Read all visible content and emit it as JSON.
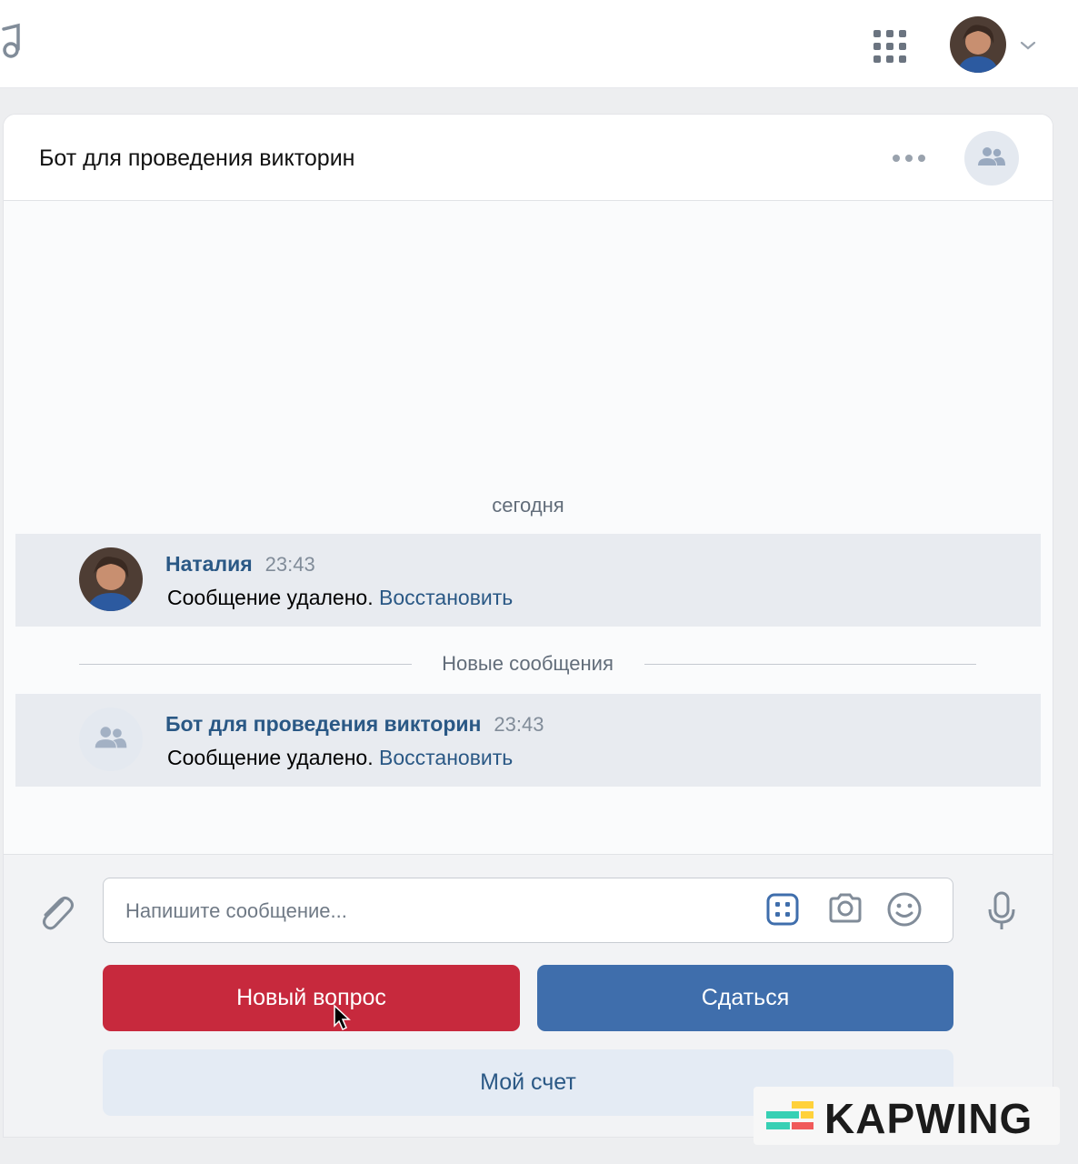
{
  "topbar": {
    "apps_icon": "grid-icon",
    "avatar_icon": "user-avatar"
  },
  "chat": {
    "title": "Бот для проведения викторин",
    "day_label": "сегодня",
    "new_messages_label": "Новые сообщения",
    "messages": [
      {
        "author": "Наталия",
        "time": "23:43",
        "text": "Сообщение удалено.",
        "action": "Восстановить"
      },
      {
        "author": "Бот для проведения викторин",
        "time": "23:43",
        "text": "Сообщение удалено.",
        "action": "Восстановить"
      }
    ]
  },
  "composer": {
    "placeholder": "Напишите сообщение..."
  },
  "keyboard": {
    "new_question": "Новый вопрос",
    "give_up": "Сдаться",
    "my_score": "Мой счет"
  },
  "watermark": {
    "text": "KAPWING"
  },
  "colors": {
    "accent_blue": "#3f6eac",
    "accent_red": "#c7293d",
    "link": "#2a5885"
  }
}
